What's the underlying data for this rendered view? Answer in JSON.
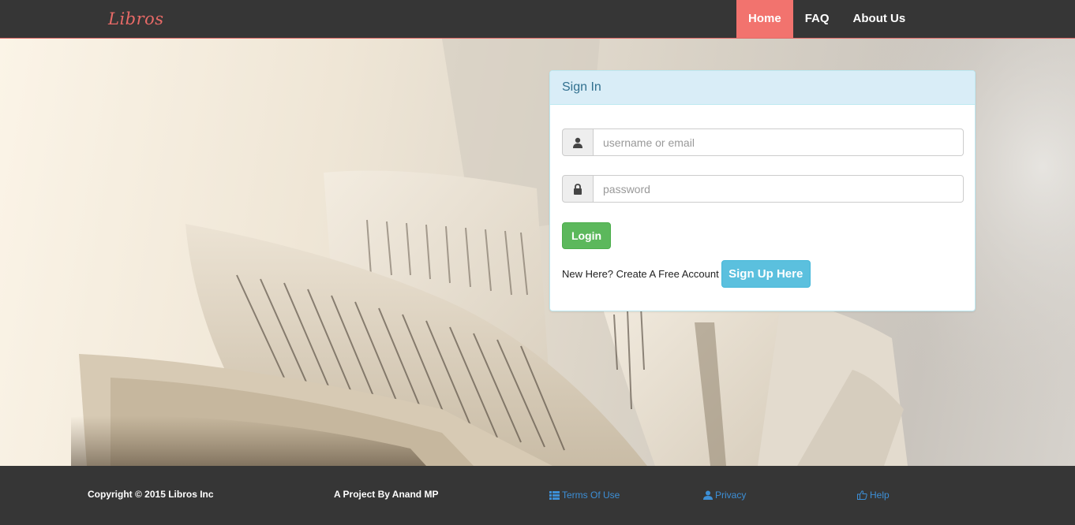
{
  "navbar": {
    "brand": "Libros",
    "links": [
      {
        "label": "Home",
        "active": true
      },
      {
        "label": "FAQ",
        "active": false
      },
      {
        "label": "About Us",
        "active": false
      }
    ],
    "accent_color": "#f2736e"
  },
  "signin": {
    "heading": "Sign In",
    "username": {
      "placeholder": "username or email",
      "value": "",
      "icon": "user-icon"
    },
    "password": {
      "placeholder": "password",
      "value": "",
      "icon": "lock-icon"
    },
    "login_label": "Login",
    "signup_prompt": "New Here? Create A Free Account",
    "signup_label": "Sign Up Here"
  },
  "footer": {
    "copyright": "Copyright © 2015 Libros Inc",
    "project_by": "A Project By Anand MP",
    "links": [
      {
        "label": "Terms Of Use",
        "icon": "list-icon"
      },
      {
        "label": "Privacy",
        "icon": "user-icon"
      },
      {
        "label": "Help",
        "icon": "thumbs-up-icon"
      }
    ]
  }
}
